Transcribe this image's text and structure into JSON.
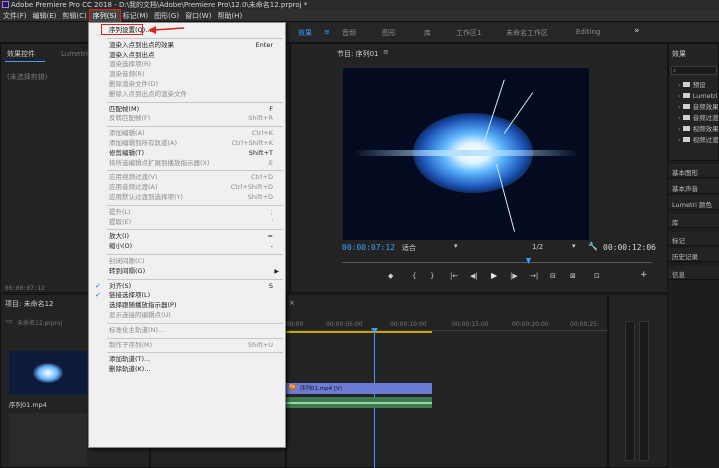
{
  "window": {
    "title": "Adobe Premiere Pro CC 2018 - D:\\我的文档\\Adobe\\Premiere Pro\\12.0\\未命名12.prproj *"
  },
  "menubar": [
    "文件(F)",
    "编辑(E)",
    "剪辑(C)",
    "序列(S)",
    "标记(M)",
    "图形(G)",
    "窗口(W)",
    "帮助(H)"
  ],
  "workspaces": {
    "items": [
      "效果",
      "音频",
      "图形",
      "库",
      "工作区1",
      "未命名工作区",
      "Editing"
    ],
    "active_menu_icon": "≡",
    "more": "»"
  },
  "left_panel": {
    "tabs": [
      "效果控件",
      "Lumetri 范"
    ],
    "no_clip": "(未选择剪辑)",
    "timecode": "00:00:07:12"
  },
  "project": {
    "title": "项目: 未命名12",
    "file": "未命名12.prproj",
    "items": [
      {
        "name": "序列01.mp4"
      },
      {
        "name": ""
      }
    ]
  },
  "program_monitor": {
    "title": "节目: 序列01",
    "current_tc": "00:00:07:12",
    "fit": "适合",
    "resolution": "1/2",
    "duration_tc": "00:00:12:06",
    "controls": [
      "◆",
      "{",
      "}",
      "|←",
      "◀|",
      "▶",
      "|▶",
      "→|",
      "⊟",
      "⊠",
      "⊡",
      "+"
    ]
  },
  "timeline": {
    "ruler": [
      "00:00",
      "00:00:05:00",
      "00:00:10:00",
      "00:00:15:00",
      "00:00:20:00",
      "00:00:25:"
    ],
    "clip_name": "序列01.mp4 [V]",
    "fx_badge": "fx"
  },
  "effects_panel": {
    "title": "效果",
    "folders": [
      "预设",
      "Lumetri 预",
      "音频效果",
      "音频过渡",
      "视频效果",
      "视频过渡"
    ],
    "side_panels": [
      "基本图形",
      "基本声音",
      "Lumetri 颜色",
      "库",
      "标记",
      "历史记录",
      "信息"
    ]
  },
  "sequence_menu": {
    "items": [
      {
        "label": "序列设置(Q)...",
        "shortcut": "",
        "enabled": true,
        "highlight": true
      },
      {
        "sep": true
      },
      {
        "label": "渲染入点到出点的效果",
        "shortcut": "Enter",
        "enabled": true
      },
      {
        "label": "渲染入点到出点",
        "shortcut": "",
        "enabled": true
      },
      {
        "label": "渲染选择项(R)",
        "shortcut": "",
        "enabled": false
      },
      {
        "label": "渲染音频(R)",
        "shortcut": "",
        "enabled": false
      },
      {
        "label": "删除渲染文件(D)",
        "shortcut": "",
        "enabled": false
      },
      {
        "label": "删除入点到出点的渲染文件",
        "shortcut": "",
        "enabled": false
      },
      {
        "sep": true
      },
      {
        "label": "匹配帧(M)",
        "shortcut": "F",
        "enabled": true
      },
      {
        "label": "反转匹配帧(F)",
        "shortcut": "Shift+R",
        "enabled": false
      },
      {
        "sep": true
      },
      {
        "label": "添加编辑(A)",
        "shortcut": "Ctrl+K",
        "enabled": false
      },
      {
        "label": "添加编辑到所有轨道(A)",
        "shortcut": "Ctrl+Shift+K",
        "enabled": false
      },
      {
        "label": "修剪编辑(T)",
        "shortcut": "Shift+T",
        "enabled": true
      },
      {
        "label": "将所选编辑点扩展到播放指示器(X)",
        "shortcut": "E",
        "enabled": false
      },
      {
        "sep": true
      },
      {
        "label": "应用视频过渡(V)",
        "shortcut": "Ctrl+D",
        "enabled": false
      },
      {
        "label": "应用音频过渡(A)",
        "shortcut": "Ctrl+Shift+D",
        "enabled": false
      },
      {
        "label": "应用默认过渡到选择项(Y)",
        "shortcut": "Shift+D",
        "enabled": false
      },
      {
        "sep": true
      },
      {
        "label": "提升(L)",
        "shortcut": ";",
        "enabled": false
      },
      {
        "label": "提取(E)",
        "shortcut": "'",
        "enabled": false
      },
      {
        "sep": true
      },
      {
        "label": "放大(I)",
        "shortcut": "=",
        "enabled": true
      },
      {
        "label": "缩小(O)",
        "shortcut": "-",
        "enabled": true
      },
      {
        "sep": true
      },
      {
        "label": "封闭间隙(C)",
        "shortcut": "",
        "enabled": false
      },
      {
        "label": "转到间隔(G)",
        "shortcut": "",
        "enabled": true,
        "submenu": true
      },
      {
        "sep": true
      },
      {
        "label": "对齐(S)",
        "shortcut": "S",
        "enabled": true,
        "checked": true
      },
      {
        "label": "链接选择项(L)",
        "shortcut": "",
        "enabled": true,
        "checked": true
      },
      {
        "label": "选择跟随播放指示器(P)",
        "shortcut": "",
        "enabled": true
      },
      {
        "label": "显示连接的编辑点(U)",
        "shortcut": "",
        "enabled": false
      },
      {
        "sep": true
      },
      {
        "label": "标准化主轨道(N)...",
        "shortcut": "",
        "enabled": false
      },
      {
        "sep": true
      },
      {
        "label": "制作子序列(M)",
        "shortcut": "Shift+U",
        "enabled": false
      },
      {
        "sep": true
      },
      {
        "label": "添加轨道(T)...",
        "shortcut": "",
        "enabled": true
      },
      {
        "label": "删除轨道(K)...",
        "shortcut": "",
        "enabled": true
      }
    ]
  },
  "colors": {
    "accent": "#3b9dff",
    "annotation": "#e0201c",
    "timecode": "#3b9dff",
    "playhead": "#3b9dff"
  }
}
